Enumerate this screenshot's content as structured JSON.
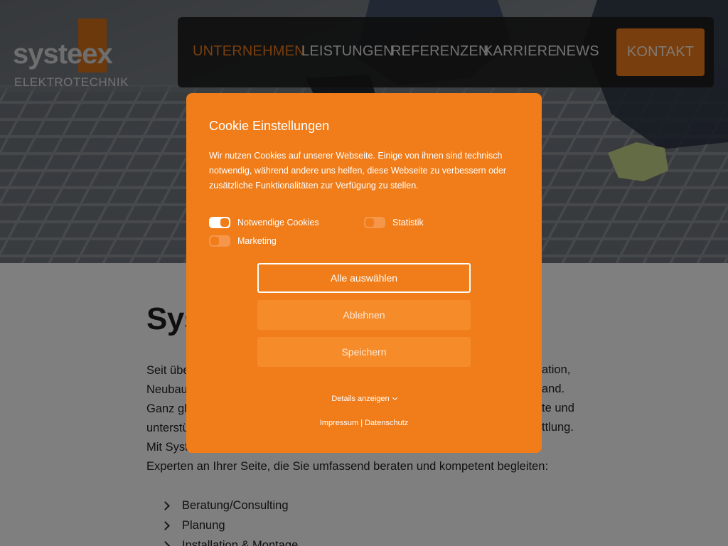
{
  "logo": {
    "word": "systeex",
    "subtitle": "ELEKTROTECHNIK"
  },
  "nav": {
    "items": [
      {
        "label": "UNTERNEHMEN",
        "active": true
      },
      {
        "label": "LEISTUNGEN",
        "active": false
      },
      {
        "label": "REFERENZEN",
        "active": false
      },
      {
        "label": "KARRIERE",
        "active": false
      },
      {
        "label": "NEWS",
        "active": false
      }
    ],
    "contact_label": "KONTAKT"
  },
  "content": {
    "title": "Sys",
    "para_lines": [
      "Seit übe",
      "Neubau",
      "Ganz gle",
      "unterstü",
      "Mit Syste",
      "Experten an Ihrer Seite, die Sie umfassend beraten und kompetent begleiten:"
    ],
    "right_fragments": [
      "ation,",
      "and.",
      "te und",
      "ttlung."
    ],
    "services": [
      "Beratung/Consulting",
      "Planung",
      "Installation & Montage"
    ]
  },
  "cookie": {
    "title": "Cookie Einstellungen",
    "text_lines": [
      "Wir nutzen Cookies auf unserer Webseite. Einige von ihnen sind technisch",
      "notwendig, während andere uns helfen, diese Webseite zu verbessern oder",
      "zusätzliche Funktionalitäten zur Verfügung zu stellen."
    ],
    "toggles": [
      {
        "label": "Notwendige Cookies",
        "on": true
      },
      {
        "label": "Statistik",
        "on": false
      },
      {
        "label": "Marketing",
        "on": false
      }
    ],
    "select_all": "Alle auswählen",
    "deny": "Ablehnen",
    "save": "Speichern",
    "details": "Details anzeigen",
    "imprint": "Impressum",
    "separator": "|",
    "privacy": "Datenschutz"
  },
  "colors": {
    "accent": "#f07d1a",
    "nav_bg": "#1c1c1c"
  }
}
